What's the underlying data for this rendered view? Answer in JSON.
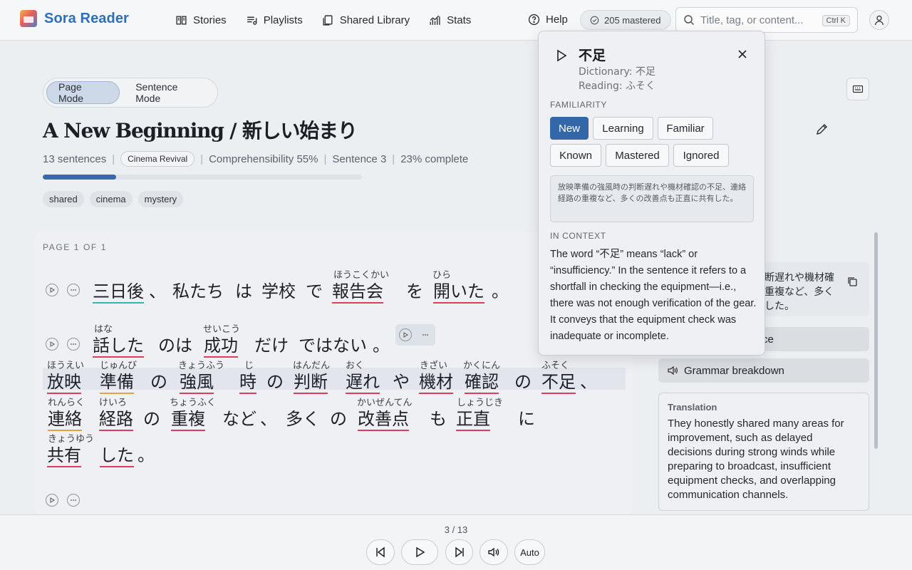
{
  "app": {
    "name": "Sora Reader"
  },
  "nav": {
    "stories": "Stories",
    "playlists": "Playlists",
    "shared_library": "Shared Library",
    "stats": "Stats",
    "help": "Help"
  },
  "mastered_badge": "205 mastered",
  "search": {
    "placeholder": "Title, tag, or content...",
    "shortcut": "Ctrl K"
  },
  "modes": {
    "page": "Page Mode",
    "sentence": "Sentence Mode",
    "active": "page"
  },
  "story": {
    "title": "A New Beginning / 新しい始まり",
    "sentences": "13 sentences",
    "collection": "Cinema Revival",
    "comprehensibility": "Comprehensibility 55%",
    "sentence_pos": "Sentence 3",
    "complete": "23% complete",
    "progress_fraction": 0.23,
    "tags": [
      "shared",
      "cinema",
      "mystery"
    ]
  },
  "reader": {
    "page_label": "PAGE 1 OF 1",
    "words": {
      "w1": "三日後",
      "w2": "、",
      "w3": "私たち",
      "w4": "は",
      "w5": "学校",
      "w6": "で",
      "w7": "報告会",
      "w8": "を",
      "w9": "開いた",
      "w10": "。",
      "w11": "話した",
      "w12": "のは",
      "w13": "成功",
      "w14": "だけ",
      "w15": "ではない",
      "w16": "。",
      "w17": "放映",
      "w18": "準備",
      "w19": "の",
      "w20": "強風",
      "w21": "時",
      "w22": "の",
      "w23": "判断",
      "w24": "遅れ",
      "w25": "や",
      "w26": "機材",
      "w27": "確認",
      "w28": "の",
      "w29": "不足",
      "w30": "、",
      "w31": "連絡",
      "w32": "経路",
      "w33": "の",
      "w34": "重複",
      "w35": "など",
      "w36": "、",
      "w37": "多く",
      "w38": "の",
      "w39": "改善点",
      "w40": "も",
      "w41": "正直",
      "w42": "に",
      "w43": "共有",
      "w44": "した",
      "w45": "。"
    },
    "ruby": {
      "r7": "ほうこくかい",
      "r9": "ひら",
      "r11": "はな",
      "r13": "せいこう",
      "r17": "ほうえい",
      "r18": "じゅんび",
      "r20": "きょうふう",
      "r21": "じ",
      "r23": "はんだん",
      "r24": "おく",
      "r26": "きざい",
      "r27": "かくにん",
      "r29": "ふそく",
      "r31": "れんらく",
      "r32": "けいろ",
      "r34": "ちょうふく",
      "r39": "かいぜんてん",
      "r41": "しょうじき",
      "r43": "きょうゆう"
    }
  },
  "popup": {
    "word": "不足",
    "dictionary": "Dictionary: 不足",
    "reading": "Reading: ふそく",
    "familiarity_label": "FAMILIARITY",
    "levels": [
      "New",
      "Learning",
      "Familiar",
      "Known",
      "Mastered",
      "Ignored"
    ],
    "selected_level": "New",
    "context_sentence": "放映準備の強風時の判断遅れや機材確認の不足、連絡経路の重複など、多くの改善点も正直に共有した。",
    "in_context_label": "IN CONTEXT",
    "explanation": "The word “不足” means “lack” or “insufficiency.” In the sentence it refers to a shortfall in checking the equipment—i.e., there was not enough verification of the gear. It conveys that the equipment check was inadequate or incomplete."
  },
  "side_panel": {
    "snippet_lines": [
      "断遅れや機材確",
      "重複など、多く",
      "した。"
    ],
    "practice_suffix": "ce",
    "grammar": "Grammar breakdown",
    "translation_label": "Translation",
    "translation_text": "They honestly shared many areas for improvement, such as delayed decisions during strong winds while preparing to broadcast, insufficient equipment checks, and overlapping communication channels."
  },
  "player": {
    "counter": "3 / 13",
    "auto": "Auto"
  },
  "colors": {
    "accent": "#3367a7",
    "underline_unknown": "#e03d5e",
    "underline_learning": "#e3a33d",
    "underline_known": "#35b4a8"
  }
}
